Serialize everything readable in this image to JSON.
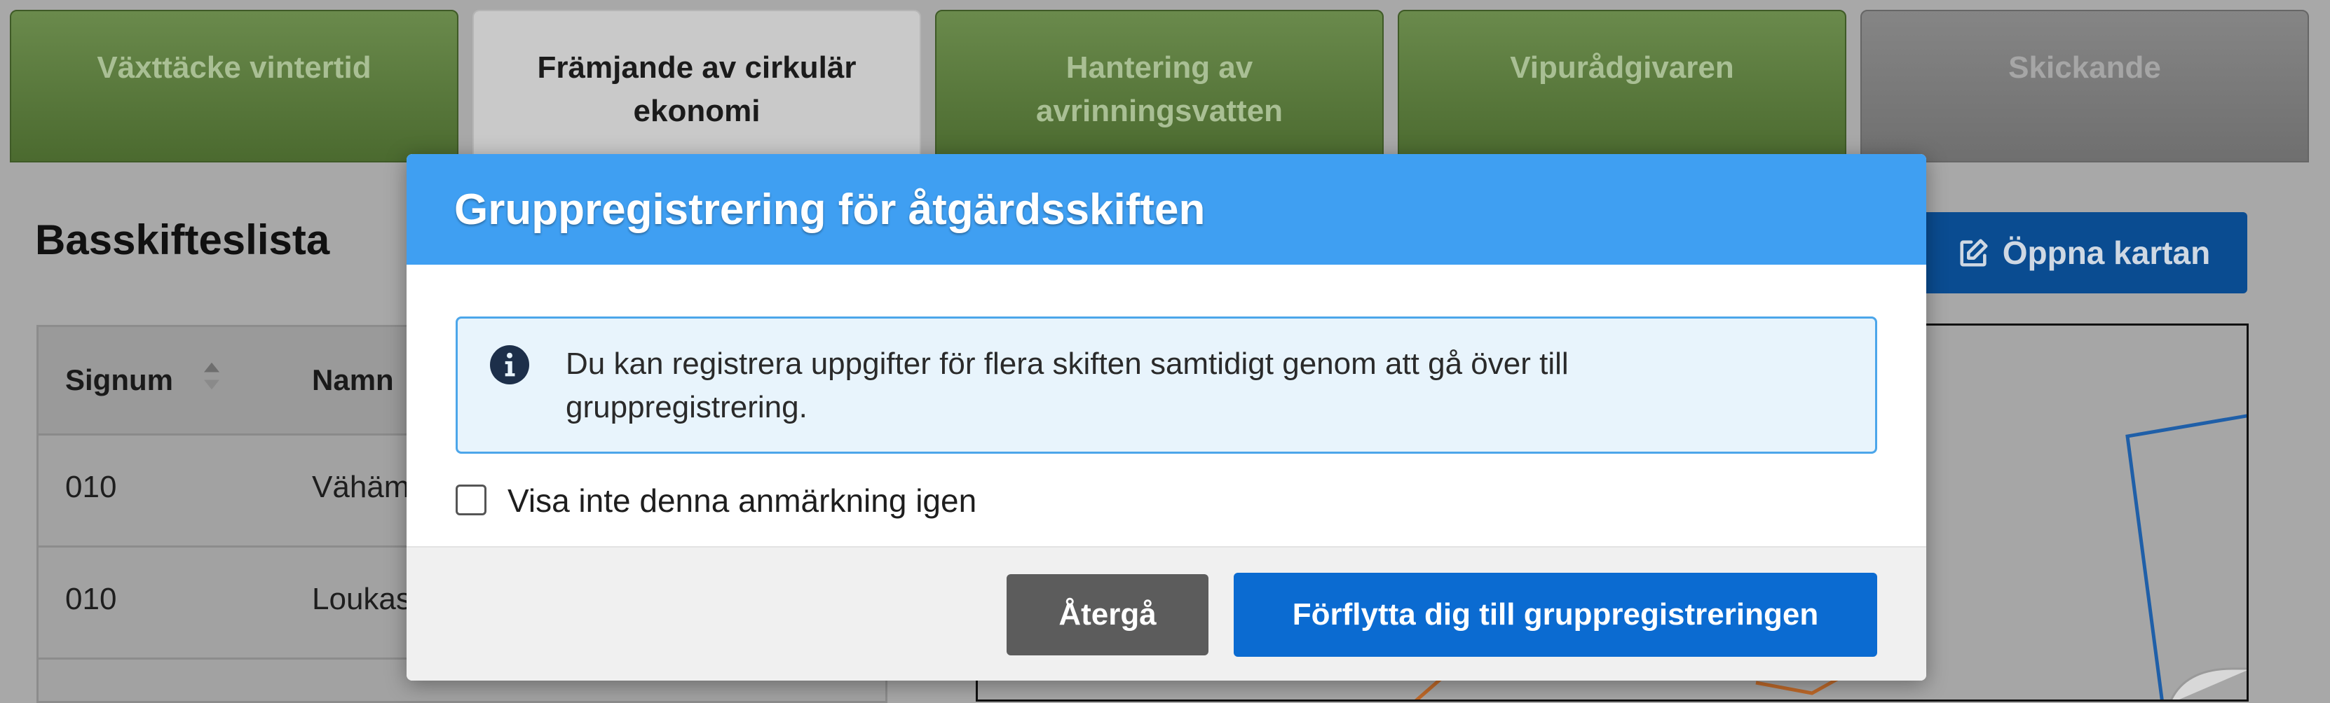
{
  "tabs": [
    {
      "label_line1": "Växttäcke vintertid",
      "label_line2": ""
    },
    {
      "label_line1": "Främjande av cirkulär",
      "label_line2": "ekonomi"
    },
    {
      "label_line1": "Hantering av",
      "label_line2": "avrinningsvatten"
    },
    {
      "label_line1": "Vipurådgivaren",
      "label_line2": ""
    },
    {
      "label_line1": "Skickande",
      "label_line2": ""
    }
  ],
  "page": {
    "title": "Basskifteslista",
    "open_map_label": "Öppna kartan"
  },
  "table": {
    "columns": [
      "Signum",
      "Namn"
    ],
    "rows": [
      {
        "signum": "010",
        "name": "Vähäm"
      },
      {
        "signum": "010",
        "name": "Loukas"
      }
    ]
  },
  "modal": {
    "title": "Gruppregistrering för åtgärdsskiften",
    "info_text": "Du kan registrera uppgifter för flera skiften samtidigt genom att gå över till gruppregistrering.",
    "checkbox_label": "Visa inte denna anmärkning igen",
    "checkbox_checked": false,
    "back_button": "Återgå",
    "go_button": "Förflytta dig till gruppregistreringen"
  },
  "colors": {
    "tab_green": "#5b7b3d",
    "modal_header": "#3f9ff2",
    "primary_button": "#0b6bd1",
    "secondary_button": "#5c5c5c",
    "overlay": "#a8a8a8"
  },
  "icons": {
    "info": "info-circle-icon",
    "edit": "edit-icon",
    "sort": "sort-icon"
  }
}
